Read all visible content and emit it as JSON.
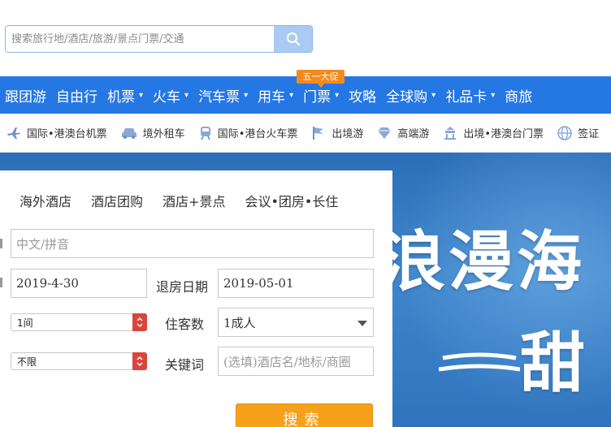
{
  "search": {
    "placeholder": "搜索旅行地/酒店/旅游/景点门票/交通"
  },
  "main_nav": {
    "items": [
      {
        "label": "跟团游",
        "caret": false
      },
      {
        "label": "自由行",
        "caret": false
      },
      {
        "label": "机票",
        "caret": true
      },
      {
        "label": "火车",
        "caret": true
      },
      {
        "label": "汽车票",
        "caret": true
      },
      {
        "label": "用车",
        "caret": true
      },
      {
        "label": "门票",
        "caret": true
      },
      {
        "label": "攻略",
        "caret": false
      },
      {
        "label": "全球购",
        "caret": true
      },
      {
        "label": "礼品卡",
        "caret": true
      },
      {
        "label": "商旅",
        "caret": false
      }
    ],
    "promo_badge": "五一大促"
  },
  "sub_nav": {
    "items": [
      {
        "label": "国际•港澳台机票",
        "icon": "plane-icon"
      },
      {
        "label": "境外租车",
        "icon": "car-icon"
      },
      {
        "label": "国际•港台火车票",
        "icon": "train-icon"
      },
      {
        "label": "出境游",
        "icon": "flag-icon"
      },
      {
        "label": "高端游",
        "icon": "diamond-icon"
      },
      {
        "label": "出境•港澳台门票",
        "icon": "ticket-icon"
      },
      {
        "label": "签证",
        "icon": "globe-icon"
      }
    ]
  },
  "hotel_panel": {
    "tabs": [
      "海外酒店",
      "酒店团购",
      "酒店+景点",
      "会议•团房•长住"
    ],
    "destination_placeholder": "中文/拼音",
    "checkin_value": "2019-4-30",
    "checkout_label": "退房日期",
    "checkout_value": "2019-05-01",
    "rooms_value": "1间",
    "guests_label": "住客数",
    "guests_value": "1成人",
    "price_value": "不限",
    "keyword_label": "关键词",
    "keyword_placeholder": "(选填)酒店名/地标/商圈",
    "search_button": "搜索"
  },
  "banner": {
    "line1": "浪漫海",
    "line2": "甜"
  },
  "colors": {
    "nav_blue": "#2577e3",
    "promo_orange": "#f48a1d",
    "search_button": "#f5a11c",
    "select_red": "#d8463b"
  }
}
